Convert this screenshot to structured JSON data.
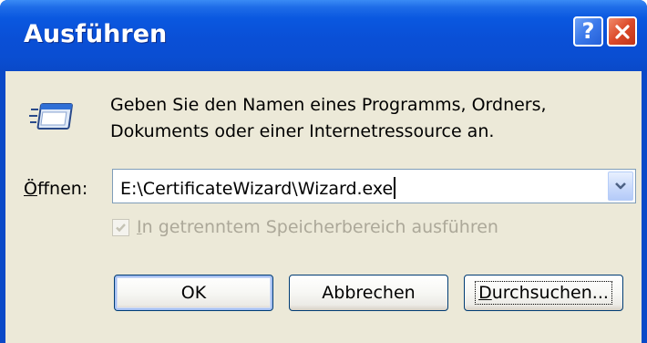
{
  "window": {
    "title": "Ausführen"
  },
  "titlebar_buttons": {
    "help_glyph": "?",
    "help_icon": "help-icon",
    "close_icon": "close-icon"
  },
  "description": {
    "line1": "Geben Sie den Namen eines Programms, Ordners,",
    "line2": "Dokuments oder einer Internetressource an."
  },
  "open": {
    "label_accel": "Ö",
    "label_rest": "ffnen:",
    "value": "E:\\CertificateWizard\\Wizard.exe"
  },
  "separate_memory": {
    "label_accel": "I",
    "label_rest": "n getrenntem Speicherbereich ausführen",
    "checked": true,
    "enabled": false
  },
  "buttons": {
    "ok": "OK",
    "cancel": "Abbrechen",
    "browse_accel": "D",
    "browse_rest": "urchsuchen..."
  },
  "colors": {
    "titlebar": "#0a4ed2",
    "client": "#ece9d8",
    "close": "#dc4a2a",
    "help": "#3a78ea",
    "disabled_text": "#aca899"
  }
}
